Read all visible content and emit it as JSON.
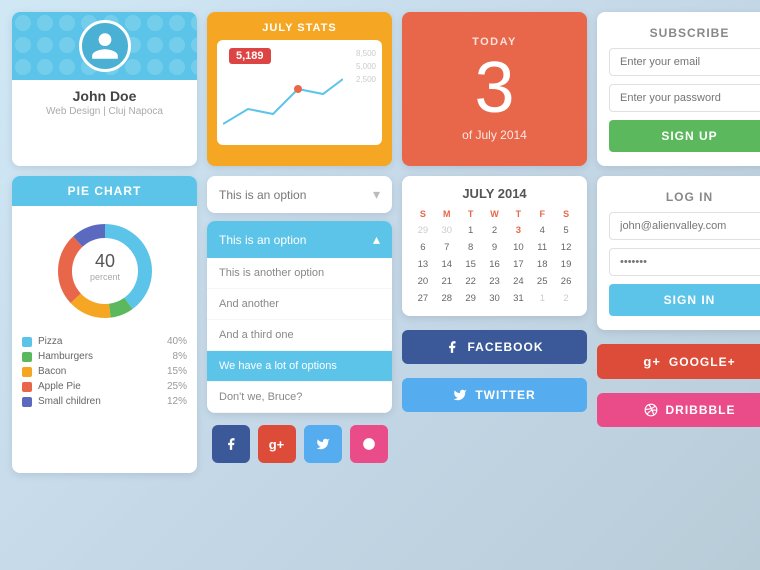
{
  "profile": {
    "name": "John Doe",
    "subtitle": "Web Design | Cluj Napoca"
  },
  "stats": {
    "title": "JULY STATS",
    "badge": "5,189",
    "labels": [
      "8,500",
      "5,000",
      "2,500"
    ]
  },
  "today": {
    "label": "TODAY",
    "number": "3",
    "sub": "of July 2014"
  },
  "subscribe": {
    "title": "SUBSCRIBE",
    "email_placeholder": "Enter your email",
    "password_placeholder": "Enter your password",
    "button": "SIGN UP"
  },
  "pie_chart": {
    "title": "PIE CHART",
    "header": "PIE CHART",
    "value": "40",
    "unit": "percent",
    "legend": [
      {
        "label": "Pizza",
        "pct": "40%",
        "color": "#5bc4e8"
      },
      {
        "label": "Hamburgers",
        "pct": "8%",
        "color": "#5cb85c"
      },
      {
        "label": "Bacon",
        "pct": "15%",
        "color": "#f5a623"
      },
      {
        "label": "Apple Pie",
        "pct": "25%",
        "color": "#e8674a"
      },
      {
        "label": "Small children",
        "pct": "12%",
        "color": "#5b6abf"
      }
    ]
  },
  "dropdown": {
    "collapsed_text": "This is an option",
    "expanded_text": "This is an option",
    "options": [
      "This is another option",
      "And another",
      "And a third one",
      "We have a lot of options",
      "Don't we, Bruce?"
    ]
  },
  "social_icons": {
    "facebook_color": "#3b5998",
    "gplus_color": "#dd4b39",
    "twitter_color": "#55acee",
    "dribbble_color": "#ea4c89"
  },
  "calendar": {
    "title": "JULY 2014",
    "headers": [
      "S",
      "M",
      "T",
      "W",
      "T",
      "F",
      "S"
    ],
    "weeks": [
      [
        "29",
        "30",
        "1",
        "2",
        "3",
        "4",
        "5"
      ],
      [
        "6",
        "7",
        "8",
        "9",
        "10",
        "11",
        "12"
      ],
      [
        "13",
        "14",
        "15",
        "16",
        "17",
        "18",
        "19"
      ],
      [
        "20",
        "21",
        "22",
        "23",
        "24",
        "25",
        "26"
      ],
      [
        "27",
        "28",
        "29",
        "30",
        "31",
        "1",
        "2"
      ]
    ],
    "today": "3",
    "facebook_label": "FACEBOOK",
    "twitter_label": "TWITTER"
  },
  "login": {
    "title": "LOG IN",
    "email": "john@alienvalley.com",
    "password": "●●●●●●●",
    "button": "SIGN IN",
    "gplus_label": "GOOGLE+",
    "dribbble_label": "DRIBBBLE"
  }
}
